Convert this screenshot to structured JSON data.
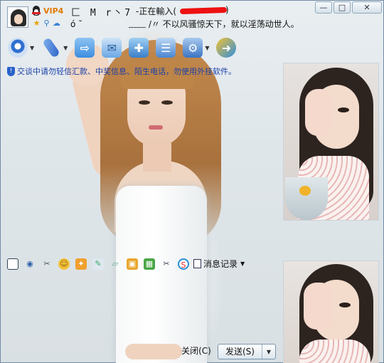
{
  "window": {
    "nickname": "匚 M r丶7",
    "status": "-正在輸入(",
    "status_close": ")",
    "vip_label": "VIP4",
    "signature": "﹏﹏ /〃 不以风骚惊天下，就以淫荡动世人。",
    "signature_prefix": "ó   ˘",
    "controls": {
      "minimize": "—",
      "maximize": "□",
      "close": "✕"
    }
  },
  "toolbar": {
    "items": [
      {
        "name": "video-call",
        "icon": "webcam-icon",
        "has_arrow": true,
        "color": "#2f6fd0"
      },
      {
        "name": "voice-call",
        "icon": "microphone-icon",
        "has_arrow": true,
        "color": "#3b78d8"
      },
      {
        "name": "file-transfer",
        "icon": "folder-icon",
        "has_arrow": false,
        "color": "#3d8ee0"
      },
      {
        "name": "send-sms",
        "icon": "envelope-icon",
        "has_arrow": false,
        "color": "#4a9de8"
      },
      {
        "name": "create-group",
        "icon": "add-group-icon",
        "has_arrow": false,
        "color": "#3aa65a"
      },
      {
        "name": "view-profile",
        "icon": "profile-icon",
        "has_arrow": false,
        "color": "#4a86d2"
      },
      {
        "name": "apps",
        "icon": "apps-icon",
        "has_arrow": true,
        "color": "#3a74c4"
      },
      {
        "name": "remote-assist",
        "icon": "remote-icon",
        "has_arrow": false,
        "color": "#2f8fe0"
      }
    ]
  },
  "notice": {
    "text": "交谈中请勿轻信汇款、中奖信息、陌生电话，勿使用外挂软件。"
  },
  "chat_tools": {
    "items": [
      "font-icon",
      "eye-icon",
      "scissors-icon",
      "emoji-icon",
      "shake-icon",
      "pencil-icon",
      "doodle-icon",
      "image-icon",
      "gift-icon",
      "scissors-screenshot-icon",
      "music-icon"
    ],
    "history_label": "消息记录"
  },
  "buttons": {
    "close": "关闭(C)",
    "send": "发送(S)"
  }
}
